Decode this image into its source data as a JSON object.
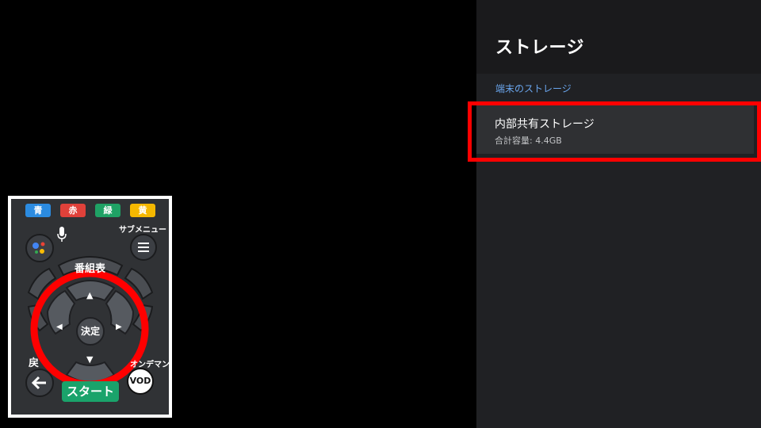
{
  "panel": {
    "title": "ストレージ",
    "section_label": "端末のストレージ",
    "items": [
      {
        "name": "内部共有ストレージ",
        "detail": "合計容量: 4.4GB"
      }
    ]
  },
  "remote": {
    "color_keys": [
      {
        "label": "青",
        "color": "#2b8be0"
      },
      {
        "label": "赤",
        "color": "#e0413a"
      },
      {
        "label": "緑",
        "color": "#1fa265"
      },
      {
        "label": "黄",
        "color": "#f5b800"
      }
    ],
    "submenu_label": "サブメニュー",
    "program_guide_label": "番組表",
    "enter_label": "決定",
    "back_label": "戻",
    "on_demand_label": "オンデマンド",
    "start_label": "スタート",
    "vod_label": "VOD",
    "dpad_up": "▲",
    "dpad_down": "▼",
    "dpad_left": "◀",
    "dpad_right": "▶"
  },
  "icons": {
    "assistant": "google-assistant-icon",
    "mic": "microphone-icon",
    "menu": "hamburger-menu-icon",
    "back": "back-arrow-icon"
  },
  "colors": {
    "highlight": "#ff0000",
    "panel_bg": "#202124",
    "panel_header_bg": "#1a1a1c",
    "section_label": "#6aa6ee",
    "selected_item_bg": "#2f3033"
  }
}
